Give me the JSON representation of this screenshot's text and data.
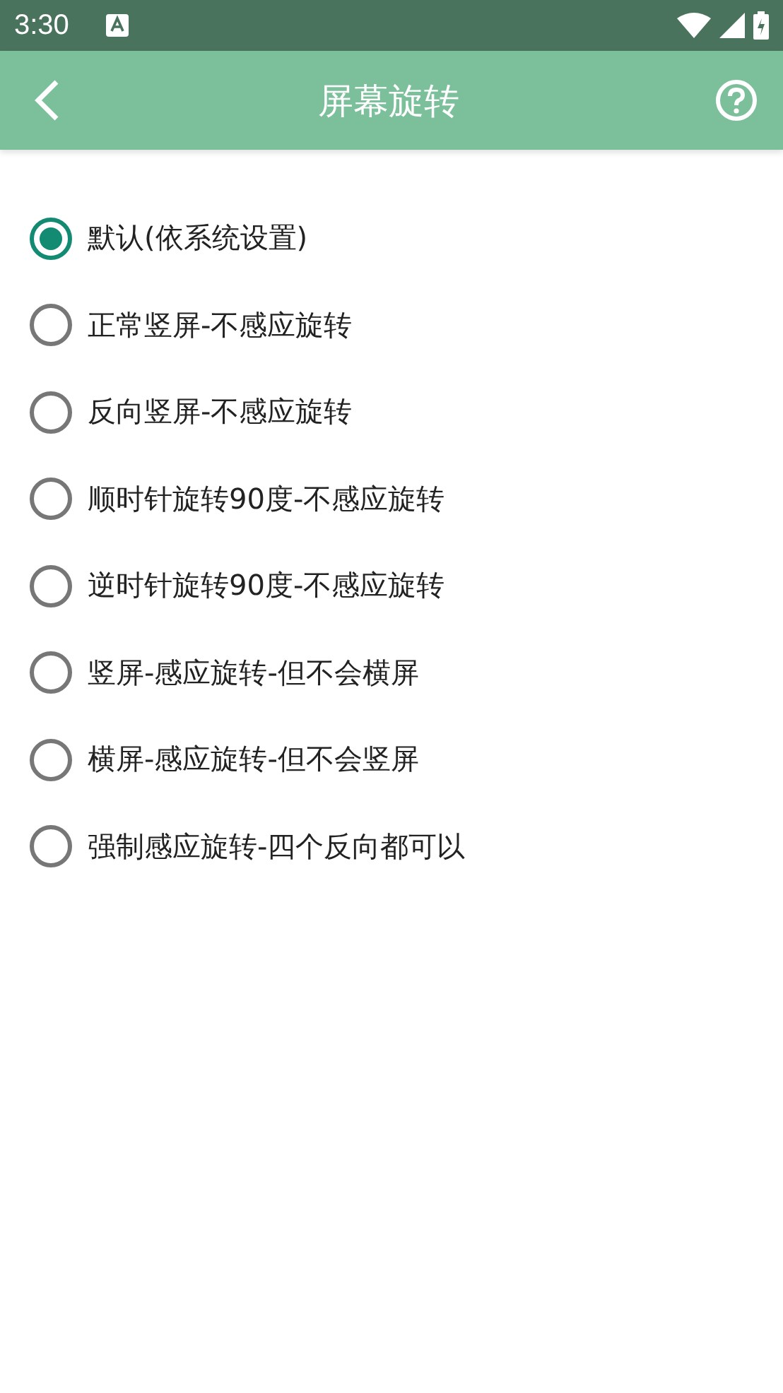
{
  "status_bar": {
    "time": "3:30"
  },
  "app_bar": {
    "title": "屏幕旋转"
  },
  "options": [
    {
      "label": "默认(依系统设置)",
      "selected": true
    },
    {
      "label": "正常竖屏-不感应旋转",
      "selected": false
    },
    {
      "label": "反向竖屏-不感应旋转",
      "selected": false
    },
    {
      "label": "顺时针旋转90度-不感应旋转",
      "selected": false
    },
    {
      "label": "逆时针旋转90度-不感应旋转",
      "selected": false
    },
    {
      "label": "竖屏-感应旋转-但不会横屏",
      "selected": false
    },
    {
      "label": "横屏-感应旋转-但不会竖屏",
      "selected": false
    },
    {
      "label": "强制感应旋转-四个反向都可以",
      "selected": false
    }
  ]
}
